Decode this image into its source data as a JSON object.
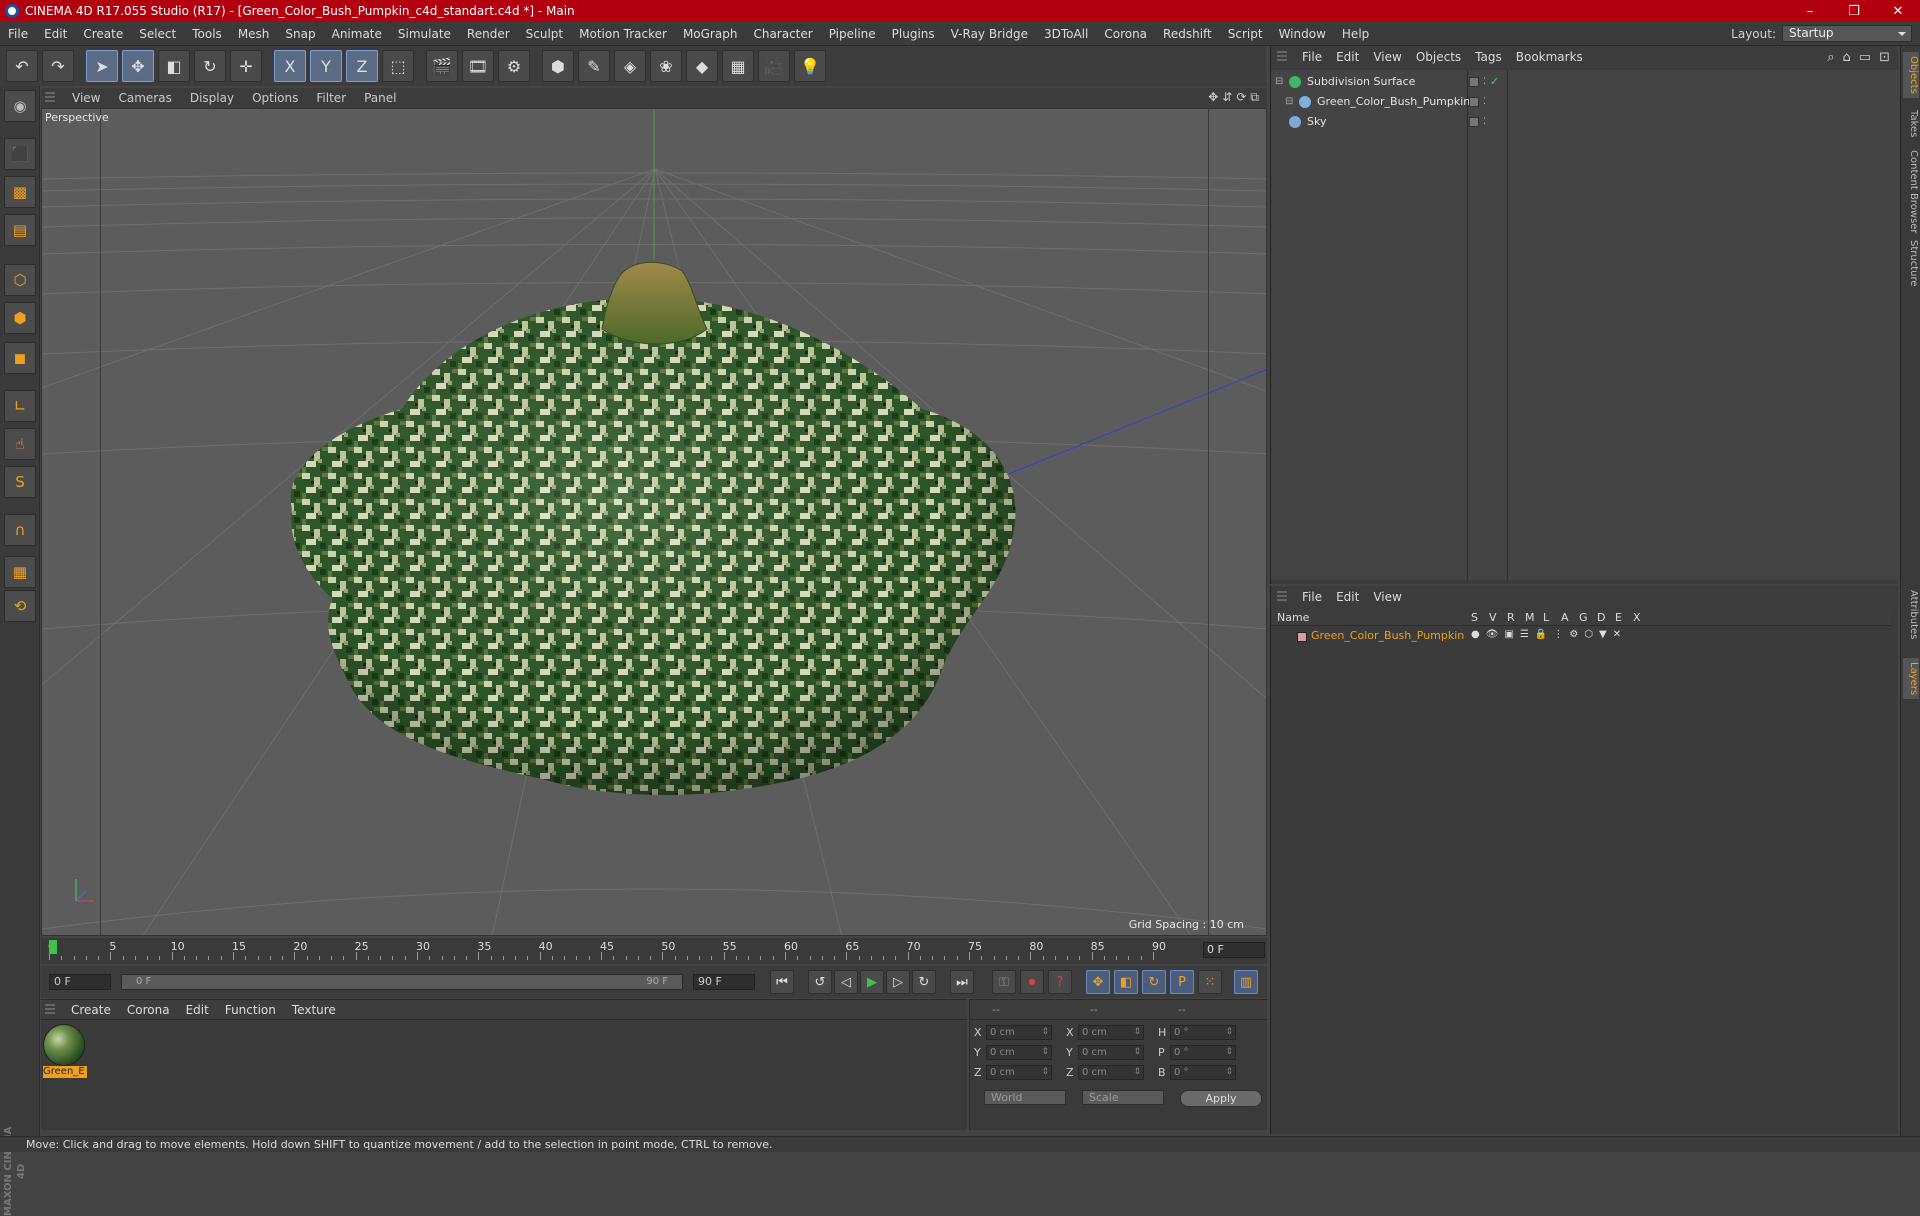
{
  "window": {
    "title": "CINEMA 4D R17.055 Studio (R17) - [Green_Color_Bush_Pumpkin_c4d_standart.c4d *] - Main",
    "controls": [
      "–",
      "❐",
      "✕"
    ]
  },
  "menubar": {
    "items": [
      "File",
      "Edit",
      "Create",
      "Select",
      "Tools",
      "Mesh",
      "Snap",
      "Animate",
      "Simulate",
      "Render",
      "Sculpt",
      "Motion Tracker",
      "MoGraph",
      "Character",
      "Pipeline",
      "Plugins",
      "V-Ray Bridge",
      "3DToAll",
      "Corona",
      "Redshift",
      "Script",
      "Window",
      "Help"
    ],
    "layout_label": "Layout:",
    "layout_value": "Startup"
  },
  "toolbar": {
    "icons": [
      "undo-icon",
      "redo-icon",
      "select-arrow-icon",
      "move-icon",
      "scale-icon",
      "rotate-icon",
      "live-select-icon",
      "x-axis-icon",
      "y-axis-icon",
      "z-axis-icon",
      "coordinate-system-icon",
      "render-view-icon",
      "render-picture-viewer-icon",
      "render-settings-icon",
      "cube-icon",
      "pen-icon",
      "subdivision-icon",
      "mograph-icon",
      "deformer-icon",
      "floor-icon",
      "camera-icon",
      "light-icon"
    ],
    "glyphs": [
      "↶",
      "↷",
      "➤",
      "✥",
      "◧",
      "↻",
      "✛",
      "X",
      "Y",
      "Z",
      "⬚",
      "🎬",
      "🎞",
      "⚙",
      "⬢",
      "✎",
      "◈",
      "❀",
      "◆",
      "▦",
      "🎥",
      "💡"
    ]
  },
  "left_tools": {
    "icons": [
      "model-mode-icon",
      "object-mode-icon",
      "texture-mode-icon",
      "workplane-icon",
      "points-mode-icon",
      "edges-mode-icon",
      "polygons-mode-icon",
      "axis-mode-icon",
      "tweak-mode-icon",
      "solo-icon",
      "snap-icon",
      "grid-lock-icon",
      "workplane-lock-icon"
    ],
    "glyphs": [
      "◉",
      "⬛",
      "▩",
      "▤",
      "⬡",
      "⬢",
      "◼",
      "∟",
      "☝",
      "S",
      "∩",
      "▦",
      "⟲"
    ]
  },
  "viewport": {
    "menu": [
      "View",
      "Cameras",
      "Display",
      "Options",
      "Filter",
      "Panel"
    ],
    "nav_icons": [
      "✥",
      "⇵",
      "⟳",
      "⧉"
    ],
    "label": "Perspective",
    "grid_spacing": "Grid Spacing : 10 cm"
  },
  "timeline": {
    "ticks": [
      0,
      5,
      10,
      15,
      20,
      25,
      30,
      35,
      40,
      45,
      50,
      55,
      60,
      65,
      70,
      75,
      80,
      85,
      90
    ],
    "current_frame": "0 F"
  },
  "transport": {
    "start_field": "0 F",
    "range_start": "0 F",
    "range_end": "90 F",
    "end_field": "90 F"
  },
  "material_manager": {
    "menu": [
      "Create",
      "Corona",
      "Edit",
      "Function",
      "Texture"
    ],
    "material_name": "Green_E"
  },
  "coordinates": {
    "header": [
      "--",
      "--",
      "--"
    ],
    "rows": [
      {
        "a": "X",
        "v1": "0 cm",
        "b": "X",
        "v2": "0 cm",
        "c": "H",
        "v3": "0 °"
      },
      {
        "a": "Y",
        "v1": "0 cm",
        "b": "Y",
        "v2": "0 cm",
        "c": "P",
        "v3": "0 °"
      },
      {
        "a": "Z",
        "v1": "0 cm",
        "b": "Z",
        "v2": "0 cm",
        "c": "B",
        "v3": "0 °"
      }
    ],
    "space": "World",
    "mode": "Scale",
    "apply": "Apply"
  },
  "object_manager": {
    "menu": [
      "File",
      "Edit",
      "View",
      "Objects",
      "Tags",
      "Bookmarks"
    ],
    "objects": [
      {
        "name": "Subdivision Surface",
        "color": "#3fb56a"
      },
      {
        "name": "Green_Color_Bush_Pumpkin",
        "color": "#7fb0e0"
      },
      {
        "name": "Sky",
        "color": "#7fa7d8"
      }
    ]
  },
  "layer_manager": {
    "menu": [
      "File",
      "Edit",
      "View"
    ],
    "columns": [
      "Name",
      "S",
      "V",
      "R",
      "M",
      "L",
      "A",
      "G",
      "D",
      "E",
      "X"
    ],
    "layer_name": "Green_Color_Bush_Pumpkin"
  },
  "right_tabs": [
    "Objects",
    "Takes",
    "Content Browser",
    "Structure",
    "Attributes",
    "Layers"
  ],
  "status": "Move: Click and drag to move elements. Hold down SHIFT to quantize movement / add to the selection in point mode, CTRL to remove.",
  "brand": "MAXON CINEMA 4D",
  "colors": {
    "accent": "#f0a020",
    "title_bar": "#b3000f",
    "pumpkin_dark": "#2f5a2a",
    "pumpkin_light": "#d9dcb8"
  }
}
